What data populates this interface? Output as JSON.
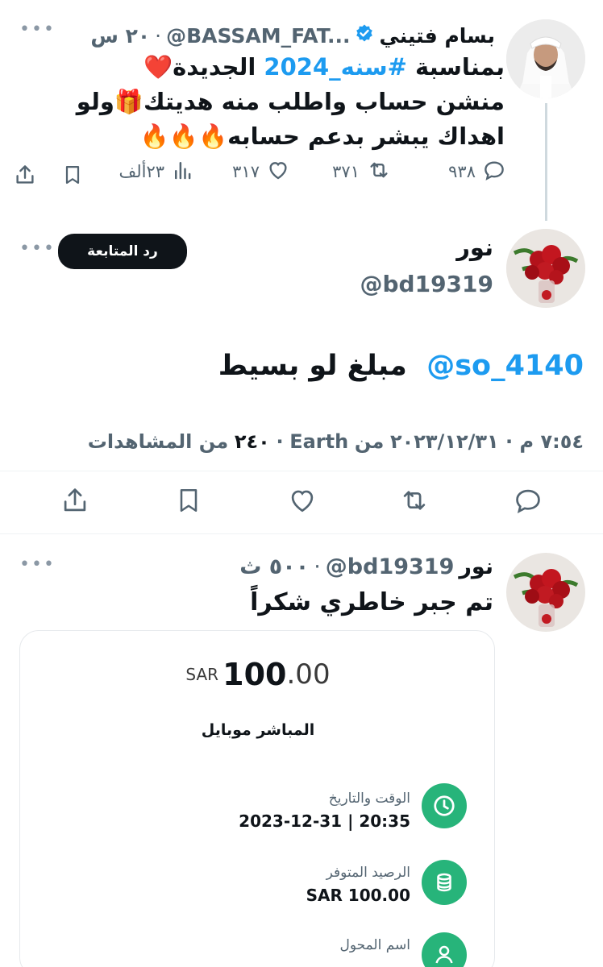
{
  "tweet1": {
    "name": "بسام فتيني",
    "handle": "@BASSAM_FAT...",
    "time": "٢٠ س",
    "line1_pre": "بمناسبة ",
    "line1_hashtag": "#سنه_2024",
    "line1_post": " الجديدة❤️",
    "line2": "منشن حساب واطلب منه هديتك🎁ولو",
    "line3": "اهداك يبشر بدعم حسابه🔥🔥🔥",
    "replies": "٩٣٨",
    "retweets": "٣٧١",
    "likes": "٣١٧",
    "views": "٢٣ألف"
  },
  "tweet2": {
    "name": "نور",
    "handle": "@bd19319",
    "follow_label": "رد المتابعة",
    "mention": "@so_4140",
    "text": "مبلغ لو بسيط",
    "meta_datetime": "٧:٥٤ م · ٢٠٢٣/١٢/٣١",
    "meta_from": "من",
    "meta_source": "Earth",
    "meta_views_count": "٢٤٠",
    "meta_views_label": "من المشاهدات"
  },
  "tweet3": {
    "name": "نور",
    "handle": "@bd19319",
    "time": "٥٠٠ ث",
    "text": "تم جبر خاطري شكراً",
    "receipt": {
      "currency": "SAR",
      "amount_main": "100",
      "amount_cents": ".00",
      "merchant": "المباشر موبايل",
      "row1_label": "الوقت والتاريخ",
      "row1_value": "2023-12-31 | 20:35",
      "row2_label": "الرصيد المتوفر",
      "row2_value": "SAR 100.00",
      "row3_label": "اسم المحول"
    }
  },
  "colors": {
    "accent": "#1d9bf0",
    "text": "#0f1419",
    "muted": "#536471",
    "receipt_green": "#27b47a"
  }
}
